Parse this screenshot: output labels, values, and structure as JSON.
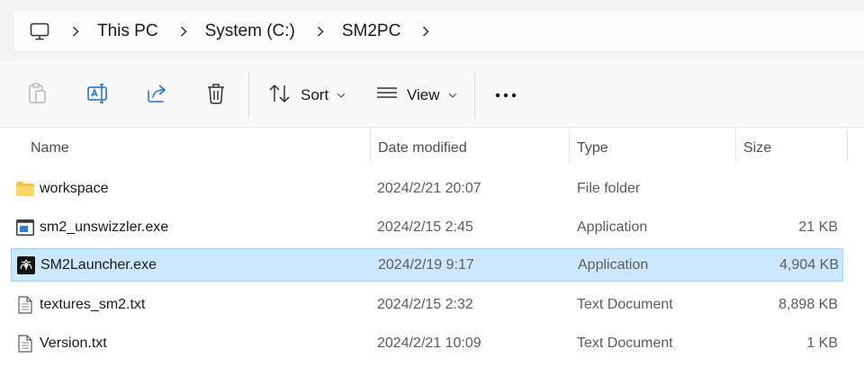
{
  "breadcrumb": {
    "root_icon": "computer-icon",
    "items": [
      "This PC",
      "System (C:)",
      "SM2PC"
    ]
  },
  "toolbar": {
    "actions": [
      "paste-icon",
      "rename-icon",
      "share-icon",
      "delete-icon"
    ],
    "sort_label": "Sort",
    "view_label": "View",
    "more_icon": "more-icon"
  },
  "columns": {
    "name": "Name",
    "date": "Date modified",
    "type": "Type",
    "size": "Size"
  },
  "files": [
    {
      "name": "workspace",
      "date": "2024/2/21 20:07",
      "type": "File folder",
      "size": "",
      "icon": "folder-icon",
      "selected": false
    },
    {
      "name": "sm2_unswizzler.exe",
      "date": "2024/2/15 2:45",
      "type": "Application",
      "size": "21 KB",
      "icon": "app-window-icon",
      "selected": false
    },
    {
      "name": "SM2Launcher.exe",
      "date": "2024/2/19 9:17",
      "type": "Application",
      "size": "4,904 KB",
      "icon": "spiderman-app-icon",
      "selected": true
    },
    {
      "name": "textures_sm2.txt",
      "date": "2024/2/15 2:32",
      "type": "Text Document",
      "size": "8,898 KB",
      "icon": "text-file-icon",
      "selected": false
    },
    {
      "name": "Version.txt",
      "date": "2024/2/21 10:09",
      "type": "Text Document",
      "size": "1 KB",
      "icon": "text-file-icon",
      "selected": false
    }
  ],
  "colors": {
    "selection_bg": "#cce8ff",
    "selection_border": "#99d1ff",
    "accent": "#0067c0",
    "folder": "#f8c843"
  }
}
